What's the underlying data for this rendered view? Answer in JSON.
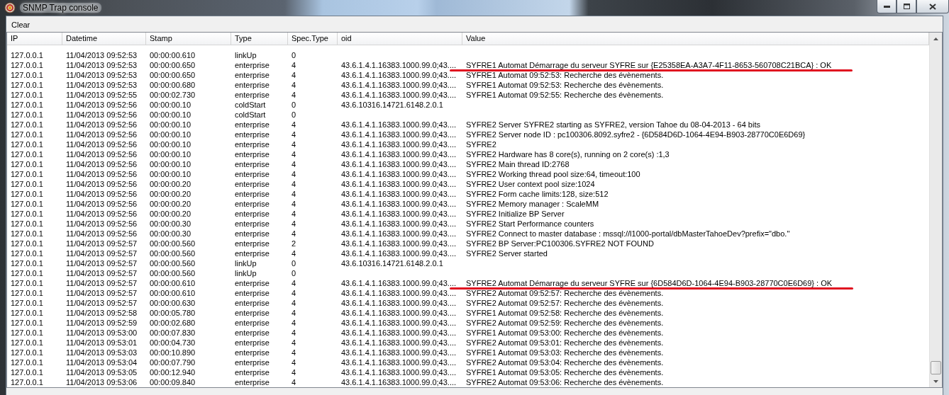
{
  "window": {
    "title": "SNMP Trap console"
  },
  "toolbar": {
    "clear_button": "Clear"
  },
  "table": {
    "columns": [
      "IP",
      "Datetime",
      "Stamp",
      "Type",
      "Spec.Type",
      "oid",
      "Value"
    ],
    "rows": [
      {
        "ip": "127.0.0.1",
        "datetime": "11/04/2013 09:52:53",
        "stamp": "00:00:00.610",
        "type": "linkUp",
        "spec_type": "0",
        "marked": false
      },
      {
        "ip": "127.0.0.1",
        "datetime": "11/04/2013 09:52:53",
        "stamp": "00:00:00.650",
        "type": "enterprise",
        "spec_type": "4",
        "oid": "43.6.1.4.1.16383.1000.99.0;43....",
        "value": "SYFRE1 Automat Démarrage du serveur SYFRE sur {E25358EA-A3A7-4F11-8653-560708C21BCA} : OK",
        "marked": true
      },
      {
        "ip": "127.0.0.1",
        "datetime": "11/04/2013 09:52:53",
        "stamp": "00:00:00.650",
        "type": "enterprise",
        "spec_type": "4",
        "oid": "43.6.1.4.1.16383.1000.99.0;43....",
        "value": "SYFRE1 Automat 09:52:53: Recherche des évènements.",
        "marked": false
      },
      {
        "ip": "127.0.0.1",
        "datetime": "11/04/2013 09:52:53",
        "stamp": "00:00:00.680",
        "type": "enterprise",
        "spec_type": "4",
        "oid": "43.6.1.4.1.16383.1000.99.0;43....",
        "value": "SYFRE1 Automat 09:52:53: Recherche des évènements.",
        "marked": false
      },
      {
        "ip": "127.0.0.1",
        "datetime": "11/04/2013 09:52:55",
        "stamp": "00:00:02.730",
        "type": "enterprise",
        "spec_type": "4",
        "oid": "43.6.1.4.1.16383.1000.99.0;43....",
        "value": "SYFRE1 Automat 09:52:55: Recherche des évènements.",
        "marked": false
      },
      {
        "ip": "127.0.0.1",
        "datetime": "11/04/2013 09:52:56",
        "stamp": "00:00:00.10",
        "type": "coldStart",
        "spec_type": "0",
        "oid": "43.6.10316.14721.6148.2.0.1",
        "marked": false
      },
      {
        "ip": "127.0.0.1",
        "datetime": "11/04/2013 09:52:56",
        "stamp": "00:00:00.10",
        "type": "coldStart",
        "spec_type": "0",
        "marked": false
      },
      {
        "ip": "127.0.0.1",
        "datetime": "11/04/2013 09:52:56",
        "stamp": "00:00:00.10",
        "type": "enterprise",
        "spec_type": "4",
        "oid": "43.6.1.4.1.16383.1000.99.0;43....",
        "value": "SYFRE2 Server SYFRE2 starting as SYFRE2, version Tahoe du 08-04-2013 - 64 bits",
        "marked": false
      },
      {
        "ip": "127.0.0.1",
        "datetime": "11/04/2013 09:52:56",
        "stamp": "00:00:00.10",
        "type": "enterprise",
        "spec_type": "4",
        "oid": "43.6.1.4.1.16383.1000.99.0;43....",
        "value": "SYFRE2 Server node ID : pc100306.8092.syfre2 - {6D584D6D-1064-4E94-B903-28770C0E6D69}",
        "marked": false
      },
      {
        "ip": "127.0.0.1",
        "datetime": "11/04/2013 09:52:56",
        "stamp": "00:00:00.10",
        "type": "enterprise",
        "spec_type": "4",
        "oid": "43.6.1.4.1.16383.1000.99.0;43....",
        "value": "SYFRE2",
        "marked": false
      },
      {
        "ip": "127.0.0.1",
        "datetime": "11/04/2013 09:52:56",
        "stamp": "00:00:00.10",
        "type": "enterprise",
        "spec_type": "4",
        "oid": "43.6.1.4.1.16383.1000.99.0;43....",
        "value": "SYFRE2 Hardware has 8 core(s), running on 2 core(s) :1,3",
        "marked": false
      },
      {
        "ip": "127.0.0.1",
        "datetime": "11/04/2013 09:52:56",
        "stamp": "00:00:00.10",
        "type": "enterprise",
        "spec_type": "4",
        "oid": "43.6.1.4.1.16383.1000.99.0;43....",
        "value": "SYFRE2 Main thread ID:2768",
        "marked": false
      },
      {
        "ip": "127.0.0.1",
        "datetime": "11/04/2013 09:52:56",
        "stamp": "00:00:00.10",
        "type": "enterprise",
        "spec_type": "4",
        "oid": "43.6.1.4.1.16383.1000.99.0;43....",
        "value": "SYFRE2 Working thread pool size:64, timeout:100",
        "marked": false
      },
      {
        "ip": "127.0.0.1",
        "datetime": "11/04/2013 09:52:56",
        "stamp": "00:00:00.20",
        "type": "enterprise",
        "spec_type": "4",
        "oid": "43.6.1.4.1.16383.1000.99.0;43....",
        "value": "SYFRE2 User context pool size:1024",
        "marked": false
      },
      {
        "ip": "127.0.0.1",
        "datetime": "11/04/2013 09:52:56",
        "stamp": "00:00:00.20",
        "type": "enterprise",
        "spec_type": "4",
        "oid": "43.6.1.4.1.16383.1000.99.0;43....",
        "value": "SYFRE2 Form cache limits:128, size:512",
        "marked": false
      },
      {
        "ip": "127.0.0.1",
        "datetime": "11/04/2013 09:52:56",
        "stamp": "00:00:00.20",
        "type": "enterprise",
        "spec_type": "4",
        "oid": "43.6.1.4.1.16383.1000.99.0;43....",
        "value": "SYFRE2 Memory manager : ScaleMM",
        "marked": false
      },
      {
        "ip": "127.0.0.1",
        "datetime": "11/04/2013 09:52:56",
        "stamp": "00:00:00.20",
        "type": "enterprise",
        "spec_type": "4",
        "oid": "43.6.1.4.1.16383.1000.99.0;43....",
        "value": "SYFRE2 Initialize BP Server",
        "marked": false
      },
      {
        "ip": "127.0.0.1",
        "datetime": "11/04/2013 09:52:56",
        "stamp": "00:00:00.30",
        "type": "enterprise",
        "spec_type": "4",
        "oid": "43.6.1.4.1.16383.1000.99.0;43....",
        "value": "SYFRE2 Start Performance counters",
        "marked": false
      },
      {
        "ip": "127.0.0.1",
        "datetime": "11/04/2013 09:52:56",
        "stamp": "00:00:00.30",
        "type": "enterprise",
        "spec_type": "4",
        "oid": "43.6.1.4.1.16383.1000.99.0;43....",
        "value": "SYFRE2 Connect to master database : mssql://l1000-portal/dbMasterTahoeDev?prefix=\"dbo.\"",
        "marked": false
      },
      {
        "ip": "127.0.0.1",
        "datetime": "11/04/2013 09:52:57",
        "stamp": "00:00:00.560",
        "type": "enterprise",
        "spec_type": "2",
        "oid": "43.6.1.4.1.16383.1000.99.0;43....",
        "value": "SYFRE2 BP Server:PC100306.SYFRE2 NOT FOUND",
        "marked": false
      },
      {
        "ip": "127.0.0.1",
        "datetime": "11/04/2013 09:52:57",
        "stamp": "00:00:00.560",
        "type": "enterprise",
        "spec_type": "4",
        "oid": "43.6.1.4.1.16383.1000.99.0;43....",
        "value": "SYFRE2 Server started",
        "marked": false
      },
      {
        "ip": "127.0.0.1",
        "datetime": "11/04/2013 09:52:57",
        "stamp": "00:00:00.560",
        "type": "linkUp",
        "spec_type": "0",
        "oid": "43.6.10316.14721.6148.2.0.1",
        "marked": false
      },
      {
        "ip": "127.0.0.1",
        "datetime": "11/04/2013 09:52:57",
        "stamp": "00:00:00.560",
        "type": "linkUp",
        "spec_type": "0",
        "marked": false
      },
      {
        "ip": "127.0.0.1",
        "datetime": "11/04/2013 09:52:57",
        "stamp": "00:00:00.610",
        "type": "enterprise",
        "spec_type": "4",
        "oid": "43.6.1.4.1.16383.1000.99.0;43....",
        "value": "SYFRE2 Automat Démarrage du serveur SYFRE sur {6D584D6D-1064-4E94-B903-28770C0E6D69} : OK",
        "marked": true
      },
      {
        "ip": "127.0.0.1",
        "datetime": "11/04/2013 09:52:57",
        "stamp": "00:00:00.610",
        "type": "enterprise",
        "spec_type": "4",
        "oid": "43.6.1.4.1.16383.1000.99.0;43....",
        "value": "SYFRE2 Automat 09:52:57: Recherche des évènements.",
        "marked": false
      },
      {
        "ip": "127.0.0.1",
        "datetime": "11/04/2013 09:52:57",
        "stamp": "00:00:00.630",
        "type": "enterprise",
        "spec_type": "4",
        "oid": "43.6.1.4.1.16383.1000.99.0;43....",
        "value": "SYFRE2 Automat 09:52:57: Recherche des évènements.",
        "marked": false
      },
      {
        "ip": "127.0.0.1",
        "datetime": "11/04/2013 09:52:58",
        "stamp": "00:00:05.780",
        "type": "enterprise",
        "spec_type": "4",
        "oid": "43.6.1.4.1.16383.1000.99.0;43....",
        "value": "SYFRE1 Automat 09:52:58: Recherche des évènements.",
        "marked": false
      },
      {
        "ip": "127.0.0.1",
        "datetime": "11/04/2013 09:52:59",
        "stamp": "00:00:02.680",
        "type": "enterprise",
        "spec_type": "4",
        "oid": "43.6.1.4.1.16383.1000.99.0;43....",
        "value": "SYFRE2 Automat 09:52:59: Recherche des évènements.",
        "marked": false
      },
      {
        "ip": "127.0.0.1",
        "datetime": "11/04/2013 09:53:00",
        "stamp": "00:00:07.830",
        "type": "enterprise",
        "spec_type": "4",
        "oid": "43.6.1.4.1.16383.1000.99.0;43....",
        "value": "SYFRE1 Automat 09:53:00: Recherche des évènements.",
        "marked": false
      },
      {
        "ip": "127.0.0.1",
        "datetime": "11/04/2013 09:53:01",
        "stamp": "00:00:04.730",
        "type": "enterprise",
        "spec_type": "4",
        "oid": "43.6.1.4.1.16383.1000.99.0;43....",
        "value": "SYFRE2 Automat 09:53:01: Recherche des évènements.",
        "marked": false
      },
      {
        "ip": "127.0.0.1",
        "datetime": "11/04/2013 09:53:03",
        "stamp": "00:00:10.890",
        "type": "enterprise",
        "spec_type": "4",
        "oid": "43.6.1.4.1.16383.1000.99.0;43....",
        "value": "SYFRE1 Automat 09:53:03: Recherche des évènements.",
        "marked": false
      },
      {
        "ip": "127.0.0.1",
        "datetime": "11/04/2013 09:53:04",
        "stamp": "00:00:07.790",
        "type": "enterprise",
        "spec_type": "4",
        "oid": "43.6.1.4.1.16383.1000.99.0;43....",
        "value": "SYFRE2 Automat 09:53:04: Recherche des évènements.",
        "marked": false
      },
      {
        "ip": "127.0.0.1",
        "datetime": "11/04/2013 09:53:05",
        "stamp": "00:00:12.940",
        "type": "enterprise",
        "spec_type": "4",
        "oid": "43.6.1.4.1.16383.1000.99.0;43....",
        "value": "SYFRE1 Automat 09:53:05: Recherche des évènements.",
        "marked": false
      },
      {
        "ip": "127.0.0.1",
        "datetime": "11/04/2013 09:53:06",
        "stamp": "00:00:09.840",
        "type": "enterprise",
        "spec_type": "4",
        "oid": "43.6.1.4.1.16383.1000.99.0;43....",
        "value": "SYFRE2 Automat 09:53:06: Recherche des évènements.",
        "marked": false
      }
    ]
  }
}
